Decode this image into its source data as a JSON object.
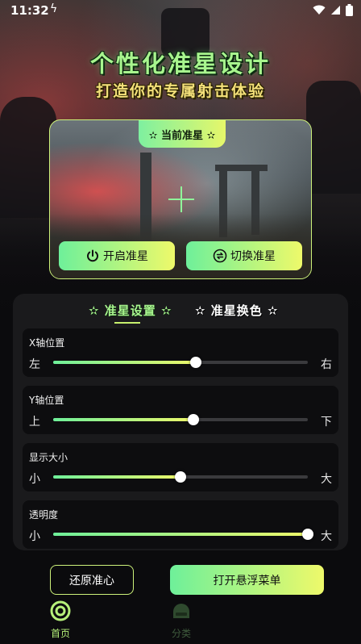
{
  "status_bar": {
    "time": "11:32"
  },
  "header": {
    "title": "个性化准星设计",
    "subtitle": "打造你的专属射击体验"
  },
  "preview": {
    "badge": "✫ 当前准星 ✫",
    "enable_button": "开启准星",
    "switch_button": "切换准星"
  },
  "settings": {
    "tabs": [
      {
        "label": "✫ 准星设置 ✫",
        "active": true
      },
      {
        "label": "✫ 准星换色 ✫",
        "active": false
      }
    ],
    "sliders": [
      {
        "label": "X轴位置",
        "min_label": "左",
        "max_label": "右",
        "value": 0.56
      },
      {
        "label": "Y轴位置",
        "min_label": "上",
        "max_label": "下",
        "value": 0.55
      },
      {
        "label": "显示大小",
        "min_label": "小",
        "max_label": "大",
        "value": 0.5
      },
      {
        "label": "透明度",
        "min_label": "小",
        "max_label": "大",
        "value": 1.0
      }
    ]
  },
  "actions": {
    "reset_button": "还原准心",
    "float_menu_button": "打开悬浮菜单"
  },
  "nav": [
    {
      "label": "首页",
      "icon": "crosshair-home-icon",
      "active": true
    },
    {
      "label": "分类",
      "icon": "category-icon",
      "active": false
    }
  ],
  "colors": {
    "accent_start": "#6ef09a",
    "accent_end": "#eef96a",
    "title_green": "#a8f58e",
    "subtitle_yellow": "#f4e07a"
  }
}
